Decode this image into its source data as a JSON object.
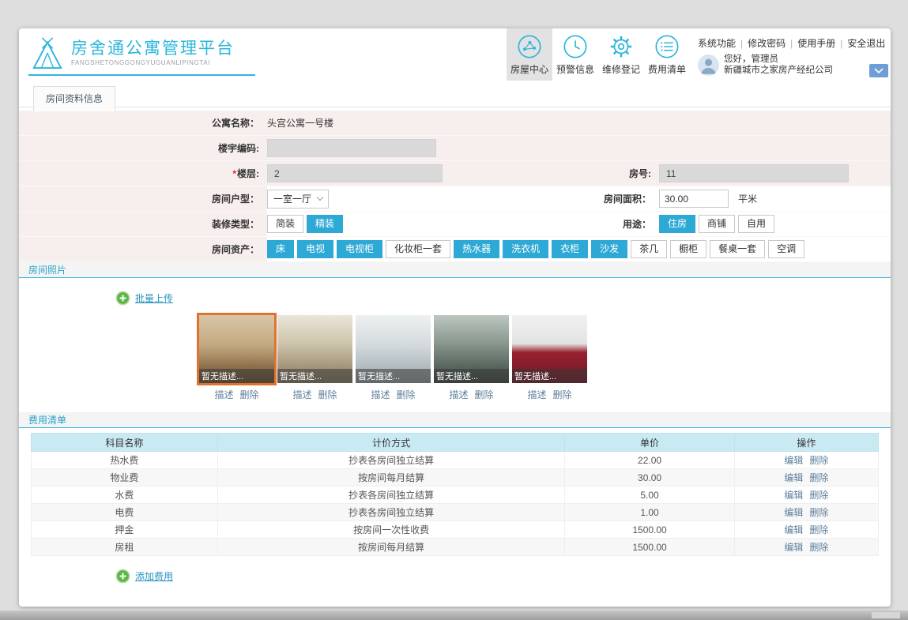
{
  "accent_color": "#2bb5dc",
  "header": {
    "title": "房舍通公寓管理平台",
    "subtitle": "FANGSHETONGGONGYUGUANLIPINGTAI",
    "nav": [
      {
        "label": "房屋中心",
        "icon": "share-network-icon",
        "selected": true
      },
      {
        "label": "预警信息",
        "icon": "clock-icon",
        "selected": false
      },
      {
        "label": "维修登记",
        "icon": "gear-icon",
        "selected": false
      },
      {
        "label": "费用清单",
        "icon": "list-circle-icon",
        "selected": false
      }
    ],
    "links": [
      "系统功能",
      "修改密码",
      "使用手册",
      "安全退出"
    ],
    "greeting": "您好，管理员",
    "company": "新疆城市之家房产经纪公司"
  },
  "tabs": {
    "active": "房间资料信息"
  },
  "form": {
    "apartment_name": {
      "label": "公寓名称：",
      "value": "头宫公寓一号楼"
    },
    "building_code": {
      "label": "楼宇编码:",
      "value": ""
    },
    "floor": {
      "required": "*",
      "label": "楼层:",
      "value": "2"
    },
    "room_no": {
      "label": "房号:",
      "value": "11"
    },
    "layout": {
      "label": "房间户型：",
      "value": "一室一厅"
    },
    "area": {
      "label": "房间面积：",
      "value": "30.00",
      "unit": "平米"
    },
    "decoration": {
      "label": "装修类型：",
      "options": [
        {
          "label": "简装",
          "selected": false
        },
        {
          "label": "精装",
          "selected": true
        }
      ]
    },
    "usage": {
      "label": "用途：",
      "options": [
        {
          "label": "住房",
          "selected": true
        },
        {
          "label": "商铺",
          "selected": false
        },
        {
          "label": "自用",
          "selected": false
        }
      ]
    },
    "assets": {
      "label": "房间资产：",
      "options": [
        {
          "label": "床",
          "selected": true
        },
        {
          "label": "电视",
          "selected": true
        },
        {
          "label": "电视柜",
          "selected": true
        },
        {
          "label": "化妆柜一套",
          "selected": false
        },
        {
          "label": "热水器",
          "selected": true
        },
        {
          "label": "洗衣机",
          "selected": true
        },
        {
          "label": "衣柜",
          "selected": true
        },
        {
          "label": "沙发",
          "selected": true
        },
        {
          "label": "茶几",
          "selected": false
        },
        {
          "label": "橱柜",
          "selected": false
        },
        {
          "label": "餐桌一套",
          "selected": false
        },
        {
          "label": "空调",
          "selected": false
        }
      ]
    }
  },
  "photos": {
    "section_title": "房间照片",
    "upload_label": "批量上传",
    "describe_label": "描述",
    "delete_label": "删除",
    "items": [
      {
        "caption": "暂无描述..."
      },
      {
        "caption": "暂无描述..."
      },
      {
        "caption": "暂无描述..."
      },
      {
        "caption": "暂无描述..."
      },
      {
        "caption": "暂无描述..."
      }
    ]
  },
  "fees": {
    "section_title": "费用清单",
    "add_label": "添加费用",
    "headers": [
      "科目名称",
      "计价方式",
      "单价",
      "操作"
    ],
    "edit_label": "编辑",
    "delete_label": "删除",
    "rows": [
      {
        "name": "热水费",
        "method": "抄表各房间独立结算",
        "price": "22.00"
      },
      {
        "name": "物业费",
        "method": "按房间每月结算",
        "price": "30.00"
      },
      {
        "name": "水费",
        "method": "抄表各房间独立结算",
        "price": "5.00"
      },
      {
        "name": "电费",
        "method": "抄表各房间独立结算",
        "price": "1.00"
      },
      {
        "name": "押金",
        "method": "按房间一次性收费",
        "price": "1500.00"
      },
      {
        "name": "房租",
        "method": "按房间每月结算",
        "price": "1500.00"
      }
    ]
  }
}
